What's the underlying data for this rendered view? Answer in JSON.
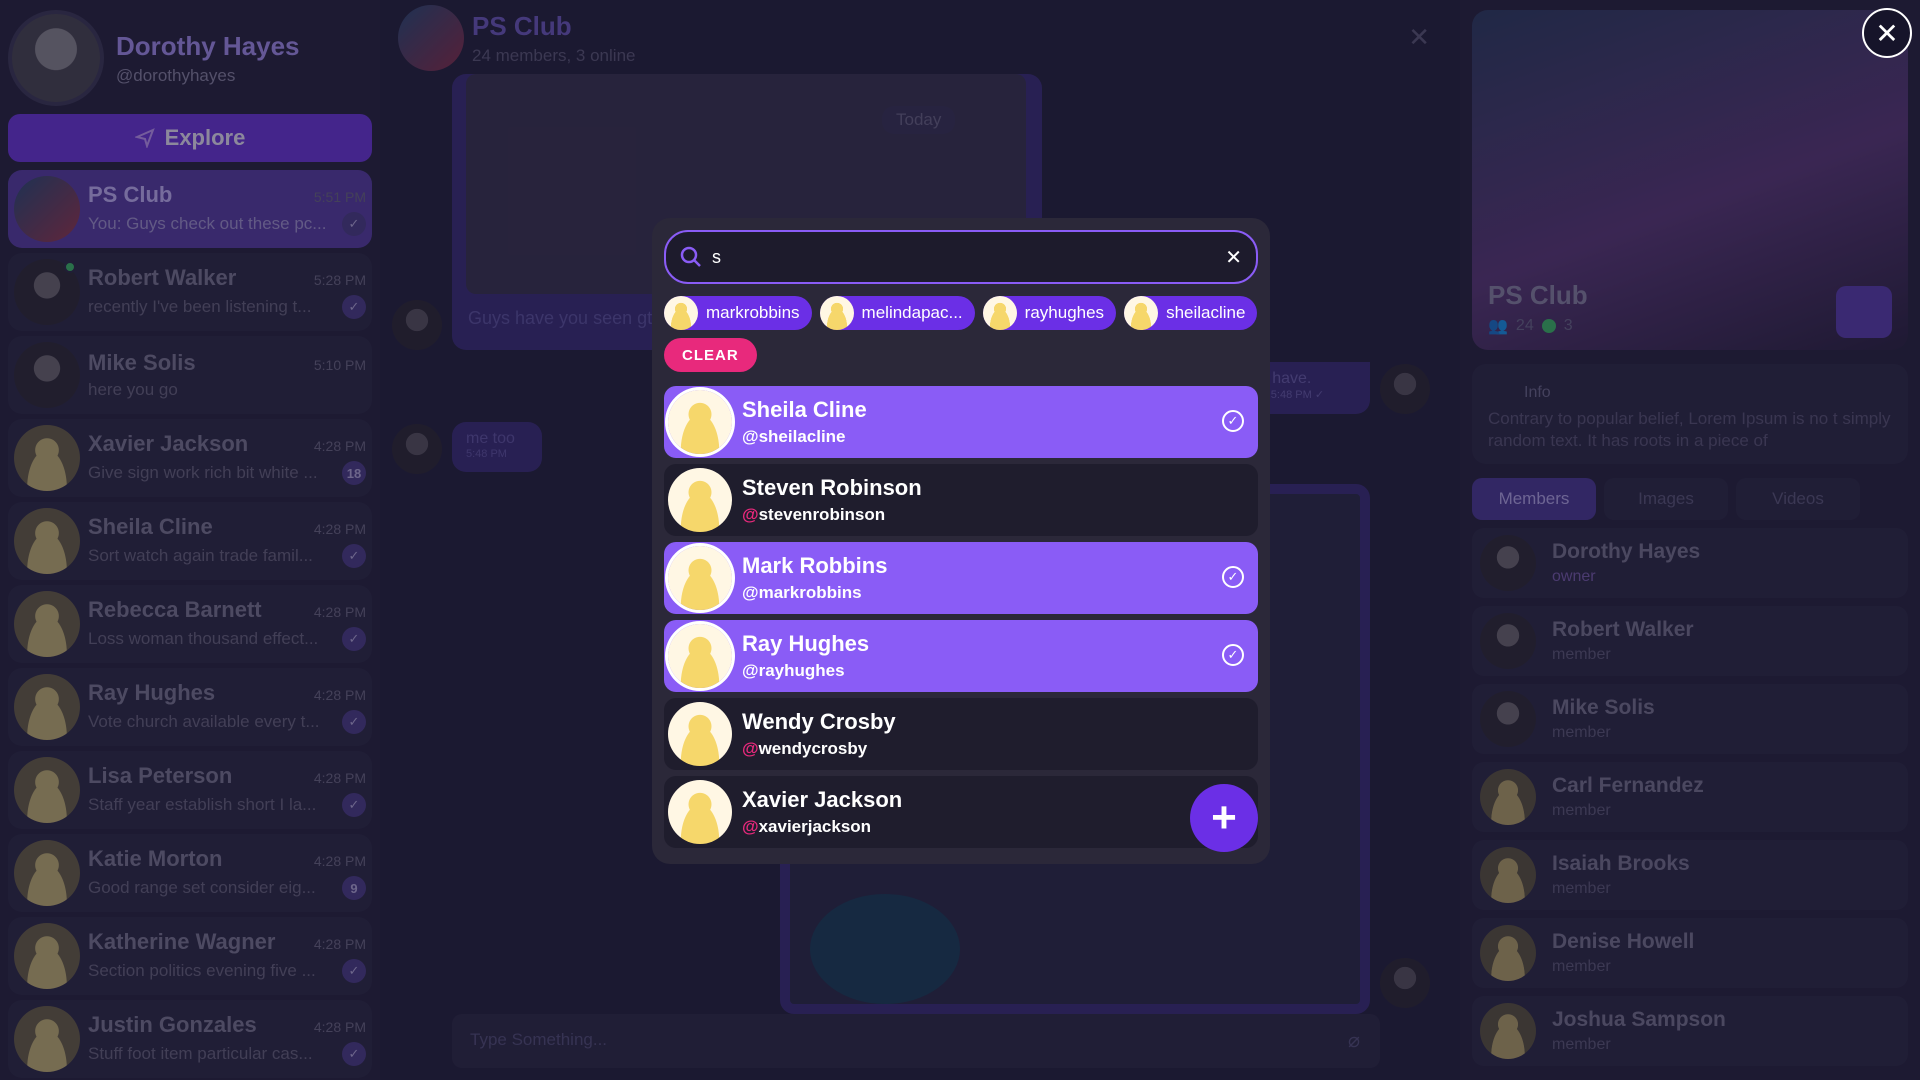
{
  "profile": {
    "name": "Dorothy Hayes",
    "handle": "@dorothyhayes"
  },
  "explore": {
    "label": "Explore",
    "icon": "send-icon"
  },
  "chats": [
    {
      "name": "PS Club",
      "time": "5:51 PM",
      "preview": "You: Guys check out these pc...",
      "badge": "✓",
      "group": true,
      "active": true
    },
    {
      "name": "Robert Walker",
      "time": "5:28 PM",
      "preview": "recently I've been listening t...",
      "badge": "✓",
      "photo": true,
      "online": true
    },
    {
      "name": "Mike Solis",
      "time": "5:10 PM",
      "preview": "here you go",
      "badge": "",
      "photo": true
    },
    {
      "name": "Xavier Jackson",
      "time": "4:28 PM",
      "preview": "Give sign work rich bit white ...",
      "badge": "18"
    },
    {
      "name": "Sheila Cline",
      "time": "4:28 PM",
      "preview": "Sort watch again trade famil...",
      "badge": "✓"
    },
    {
      "name": "Rebecca Barnett",
      "time": "4:28 PM",
      "preview": "Loss woman thousand effect...",
      "badge": "✓"
    },
    {
      "name": "Ray Hughes",
      "time": "4:28 PM",
      "preview": "Vote church available every t...",
      "badge": "✓"
    },
    {
      "name": "Lisa Peterson",
      "time": "4:28 PM",
      "preview": "Staff year establish short I la...",
      "badge": "✓"
    },
    {
      "name": "Katie Morton",
      "time": "4:28 PM",
      "preview": "Good range set consider eig...",
      "badge": "9"
    },
    {
      "name": "Katherine Wagner",
      "time": "4:28 PM",
      "preview": "Section politics evening five ...",
      "badge": "✓"
    },
    {
      "name": "Justin Gonzales",
      "time": "4:28 PM",
      "preview": "Stuff foot item particular cas...",
      "badge": "✓"
    }
  ],
  "chat": {
    "title": "PS Club",
    "subtitle": "24 members, 3 online",
    "today": "Today",
    "caption": "Guys have you seen gt",
    "small_msg": "me too",
    "small_time": "5:48 PM",
    "right_msg": "a I have.",
    "right_time": "ited 5:48 PM ✓",
    "composer_placeholder": "Type Something..."
  },
  "group_panel": {
    "title": "PS Club",
    "members_count": "24",
    "online_count": "3",
    "info_title": "Info",
    "info_text": "Contrary to popular belief, Lorem Ipsum is no t simply random text. It has roots in a piece of",
    "tabs": [
      "Members",
      "Images",
      "Videos"
    ]
  },
  "members": [
    {
      "name": "Dorothy Hayes",
      "role": "owner",
      "photo": true
    },
    {
      "name": "Robert Walker",
      "role": "member",
      "photo": true
    },
    {
      "name": "Mike Solis",
      "role": "member",
      "photo": true
    },
    {
      "name": "Carl Fernandez",
      "role": "member"
    },
    {
      "name": "Isaiah Brooks",
      "role": "member"
    },
    {
      "name": "Denise Howell",
      "role": "member"
    },
    {
      "name": "Joshua Sampson",
      "role": "member"
    }
  ],
  "modal": {
    "search_value": "s",
    "chips": [
      "markrobbins",
      "melindapac...",
      "rayhughes",
      "sheilacline"
    ],
    "clear_label": "CLEAR",
    "results": [
      {
        "name": "Sheila Cline",
        "handle": "sheilacline",
        "selected": true
      },
      {
        "name": "Steven Robinson",
        "handle": "stevenrobinson",
        "selected": false
      },
      {
        "name": "Mark Robbins",
        "handle": "markrobbins",
        "selected": true
      },
      {
        "name": "Ray Hughes",
        "handle": "rayhughes",
        "selected": true
      },
      {
        "name": "Wendy Crosby",
        "handle": "wendycrosby",
        "selected": false
      },
      {
        "name": "Xavier Jackson",
        "handle": "xavierjackson",
        "selected": false
      }
    ],
    "add_icon": "+"
  },
  "overlay_close": "✕",
  "colors": {
    "accent": "#8a5cf6",
    "accent_dark": "#6b2fe6",
    "pink": "#e8297c",
    "modal_bg": "#2b2839"
  }
}
